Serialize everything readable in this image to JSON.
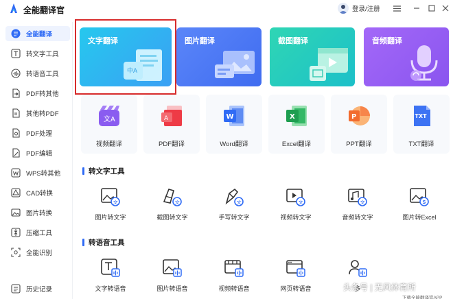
{
  "app": {
    "title": "全能翻译官",
    "login": "登录/注册"
  },
  "sidebar": {
    "items": [
      {
        "label": "全能翻译",
        "icon": "translate-icon"
      },
      {
        "label": "转文字工具",
        "icon": "text-tool-icon"
      },
      {
        "label": "转语音工具",
        "icon": "voice-tool-icon"
      },
      {
        "label": "PDF转其他",
        "icon": "pdf-convert-icon"
      },
      {
        "label": "其他转PDF",
        "icon": "to-pdf-icon"
      },
      {
        "label": "PDF处理",
        "icon": "pdf-process-icon"
      },
      {
        "label": "PDF编辑",
        "icon": "pdf-edit-icon"
      },
      {
        "label": "WPS转其他",
        "icon": "wps-icon"
      },
      {
        "label": "CAD转换",
        "icon": "cad-icon"
      },
      {
        "label": "图片转换",
        "icon": "image-convert-icon"
      },
      {
        "label": "压缩工具",
        "icon": "compress-icon"
      },
      {
        "label": "全能识别",
        "icon": "recognize-icon"
      },
      {
        "label": "历史记录",
        "icon": "history-icon"
      }
    ]
  },
  "cards": [
    {
      "label": "文字翻译"
    },
    {
      "label": "图片翻译"
    },
    {
      "label": "截图翻译"
    },
    {
      "label": "音频翻译"
    }
  ],
  "translate_tiles": [
    {
      "label": "视频翻译"
    },
    {
      "label": "PDF翻译"
    },
    {
      "label": "Word翻译"
    },
    {
      "label": "Excel翻译"
    },
    {
      "label": "PPT翻译"
    },
    {
      "label": "TXT翻译"
    }
  ],
  "sections": {
    "text_tools": "转文字工具",
    "voice_tools": "转语音工具"
  },
  "text_tools": [
    {
      "label": "图片转文字"
    },
    {
      "label": "截图转文字"
    },
    {
      "label": "手写转文字"
    },
    {
      "label": "视频转文字"
    },
    {
      "label": "音频转文字"
    },
    {
      "label": "图片转Excel"
    }
  ],
  "voice_tools": [
    {
      "label": "文字转语音"
    },
    {
      "label": "图片转语音"
    },
    {
      "label": "视频转语音"
    },
    {
      "label": "网页转语音"
    },
    {
      "label": "多"
    }
  ],
  "watermark": {
    "main": "头条号 | 无风体育所",
    "sub": "下载全能翻译官APP"
  },
  "colors": {
    "accent": "#2f6bf5",
    "highlight_border": "#d72b2b"
  }
}
